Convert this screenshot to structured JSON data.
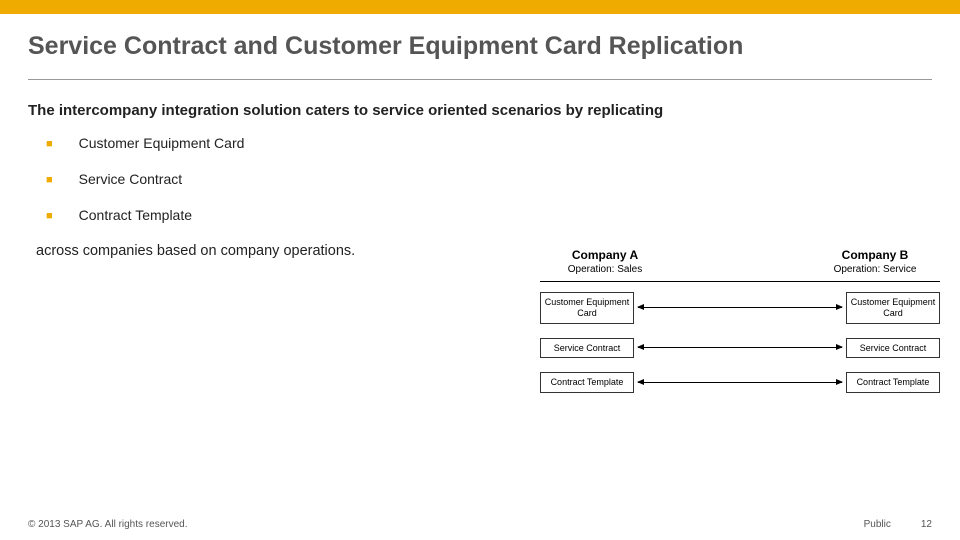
{
  "header": {
    "title": "Service Contract and Customer Equipment Card Replication"
  },
  "body": {
    "intro": "The intercompany integration solution caters to service oriented scenarios by replicating",
    "bullets": [
      "Customer Equipment Card",
      "Service Contract",
      "Contract Template"
    ],
    "closing": "across companies based on company operations."
  },
  "diagram": {
    "companyA": {
      "name": "Company A",
      "operation": "Operation: Sales"
    },
    "companyB": {
      "name": "Company B",
      "operation": "Operation: Service"
    },
    "rows": [
      {
        "left": "Customer Equipment Card",
        "right": "Customer Equipment Card"
      },
      {
        "left": "Service Contract",
        "right": "Service Contract"
      },
      {
        "left": "Contract Template",
        "right": "Contract Template"
      }
    ]
  },
  "footer": {
    "copyright": "© 2013 SAP AG. All rights reserved.",
    "classification": "Public",
    "page": "12"
  }
}
